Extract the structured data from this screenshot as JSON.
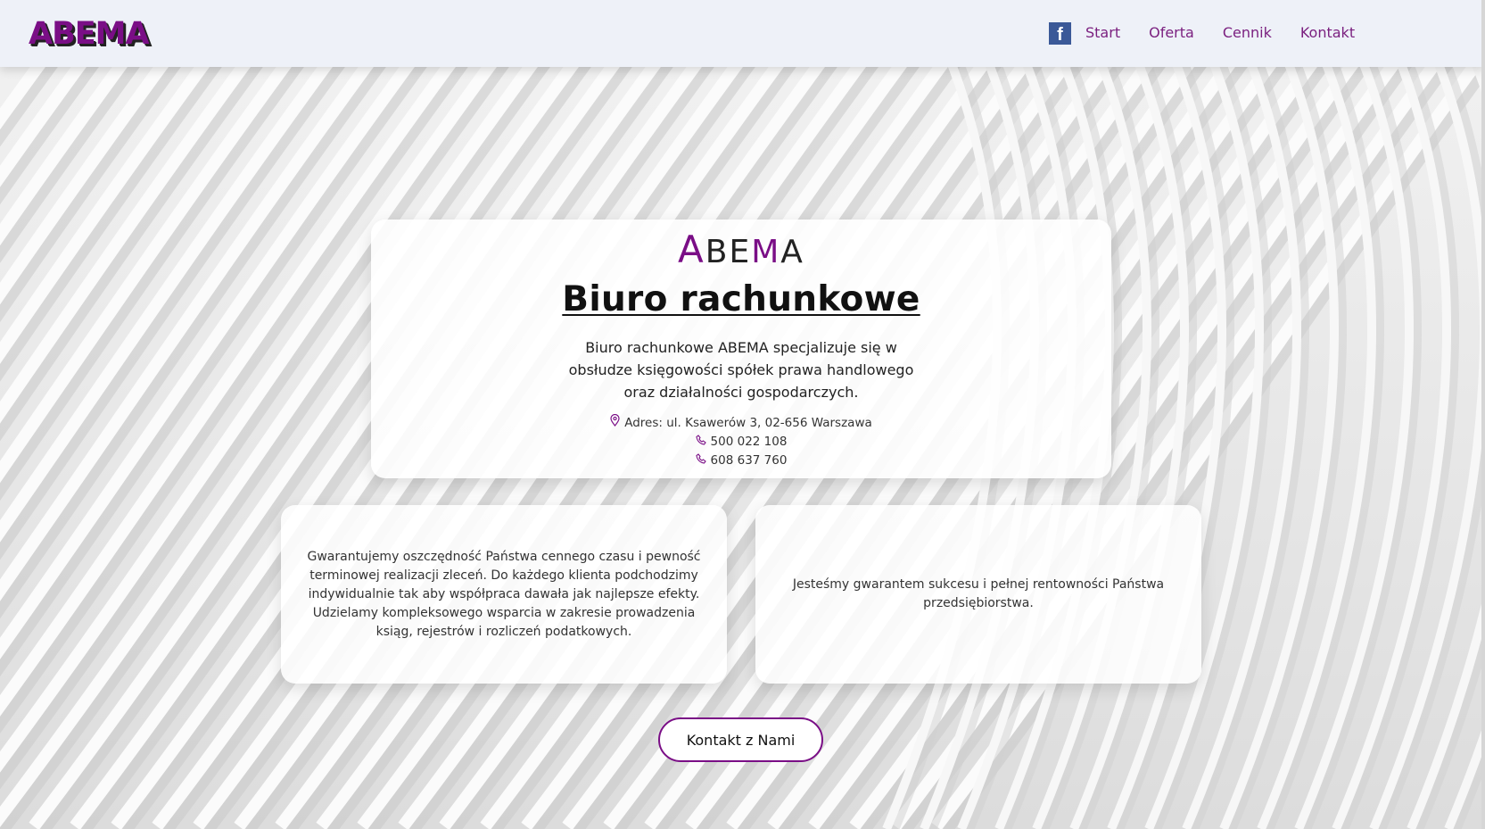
{
  "header": {
    "logo": "ABEMA",
    "facebook_icon": "facebook-icon",
    "facebook_letter": "f",
    "nav": [
      {
        "label": "Start"
      },
      {
        "label": "Oferta"
      },
      {
        "label": "Cennik"
      },
      {
        "label": "Kontakt"
      }
    ]
  },
  "main": {
    "brand_parts": [
      "A",
      "BE",
      "M",
      "A"
    ],
    "title": "Biuro rachunkowe",
    "description": "Biuro rachunkowe ABEMA specjalizuje się w obsłudze księgowości spółek prawa handlowego oraz działalności gospodarczych.",
    "address": "Adres: ul. Ksawerów 3, 02-656 Warszawa",
    "phone1": "500 022 108",
    "phone2": "608 637 760",
    "address_icon": "map-pin-icon",
    "phone_icon": "phone-icon"
  },
  "cards": {
    "left": "Gwarantujemy oszczędność Państwa cennego czasu i pewność terminowej realizacji zleceń. Do każdego klienta podchodzimy indywidualnie tak aby współpraca dawała jak najlepsze efekty. Udzielamy kompleksowego wsparcia w zakresie prowadzenia ksiąg, rejestrów i rozliczeń podatkowych.",
    "right": "Jesteśmy gwarantem sukcesu i pełnej rentowności Państwa przedsiębiorstwa."
  },
  "cta": {
    "label": "Kontakt z Nami"
  },
  "colors": {
    "accent": "#7a0e86",
    "header_bg": "#eef1f8",
    "facebook": "#3b5998"
  }
}
